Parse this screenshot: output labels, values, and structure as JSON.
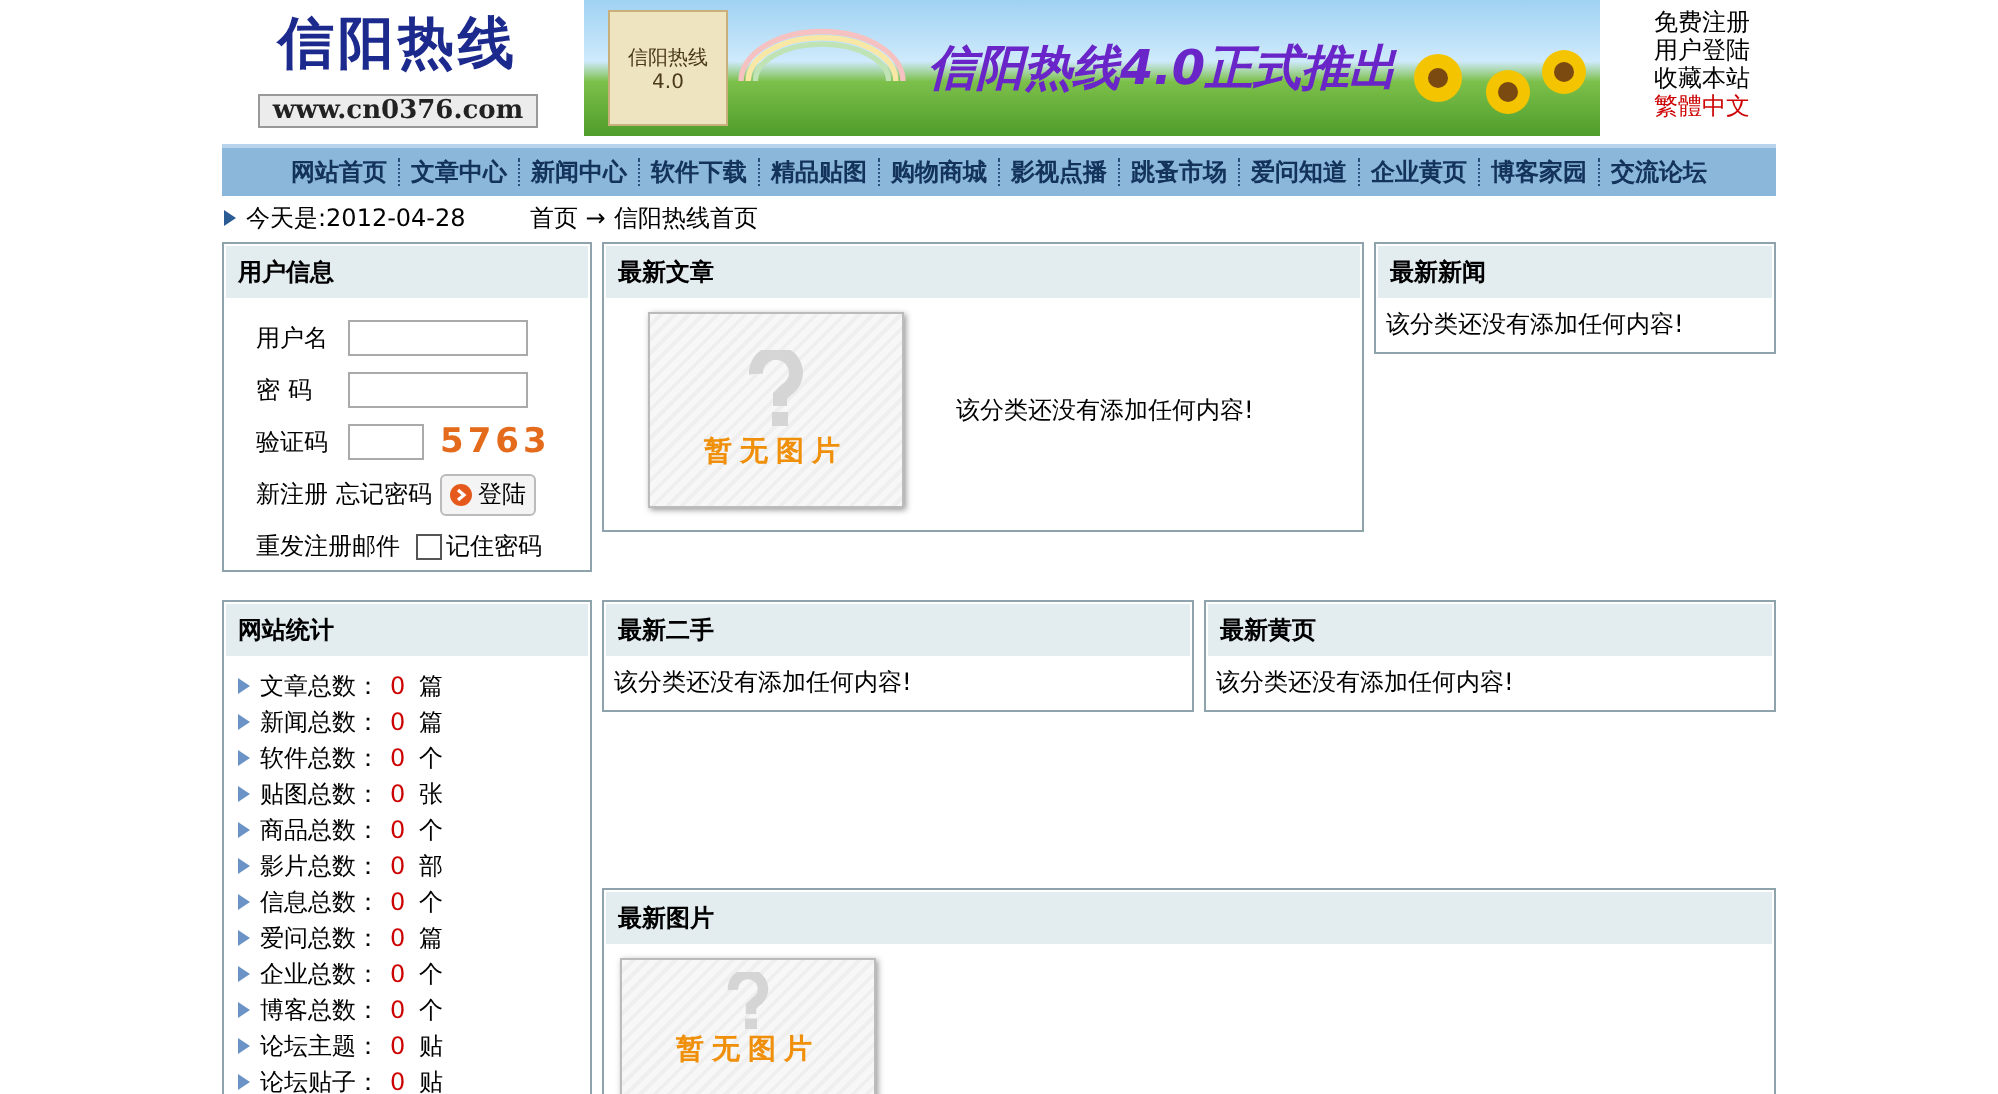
{
  "header": {
    "logo_title": "信阳热线",
    "logo_url": "www.cn0376.com",
    "banner_scroll_title": "信阳热线",
    "banner_scroll_version": "4.0",
    "banner_title": "信阳热线4.0正式推出",
    "links": [
      {
        "label": "免费注册",
        "highlight": false
      },
      {
        "label": "用户登陆",
        "highlight": false
      },
      {
        "label": "收藏本站",
        "highlight": false
      },
      {
        "label": "繁體中文",
        "highlight": true
      }
    ]
  },
  "nav": [
    "网站首页",
    "文章中心",
    "新闻中心",
    "软件下载",
    "精品贴图",
    "购物商城",
    "影视点播",
    "跳蚤市场",
    "爱问知道",
    "企业黄页",
    "博客家园",
    "交流论坛"
  ],
  "breadcrumb": {
    "date": "今天是:2012-04-28",
    "home": "首页",
    "arrow": "→",
    "current": "信阳热线首页"
  },
  "user_panel": {
    "title": "用户信息",
    "username_label": "用户名",
    "password_label": "密 码",
    "captcha_label": "验证码",
    "captcha": "5763",
    "register": "新注册",
    "forgot": "忘记密码",
    "login": "登陆",
    "resend": "重发注册邮件",
    "remember": {
      "label": "记住密码",
      "checked": false
    }
  },
  "stats_panel": {
    "title": "网站统计",
    "items": [
      {
        "label": "文章总数：",
        "value": "0",
        "unit": "篇"
      },
      {
        "label": "新闻总数：",
        "value": "0",
        "unit": "篇"
      },
      {
        "label": "软件总数：",
        "value": "0",
        "unit": "个"
      },
      {
        "label": "贴图总数：",
        "value": "0",
        "unit": "张"
      },
      {
        "label": "商品总数：",
        "value": "0",
        "unit": "个"
      },
      {
        "label": "影片总数：",
        "value": "0",
        "unit": "部"
      },
      {
        "label": "信息总数：",
        "value": "0",
        "unit": "个"
      },
      {
        "label": "爱问总数：",
        "value": "0",
        "unit": "篇"
      },
      {
        "label": "企业总数：",
        "value": "0",
        "unit": "个"
      },
      {
        "label": "博客总数：",
        "value": "0",
        "unit": "个"
      },
      {
        "label": "论坛主题：",
        "value": "0",
        "unit": "贴"
      },
      {
        "label": "论坛贴子：",
        "value": "0",
        "unit": "贴"
      }
    ]
  },
  "articles": {
    "title": "最新文章",
    "image_text": "暂无图片",
    "message": "该分类还没有添加任何内容!"
  },
  "news": {
    "title": "最新新闻",
    "message": "该分类还没有添加任何内容!"
  },
  "secondhand": {
    "title": "最新二手",
    "message": "该分类还没有添加任何内容!"
  },
  "yellow_pages": {
    "title": "最新黄页",
    "message": "该分类还没有添加任何内容!"
  },
  "pictures": {
    "title": "最新图片",
    "image_text": "暂无图片"
  }
}
